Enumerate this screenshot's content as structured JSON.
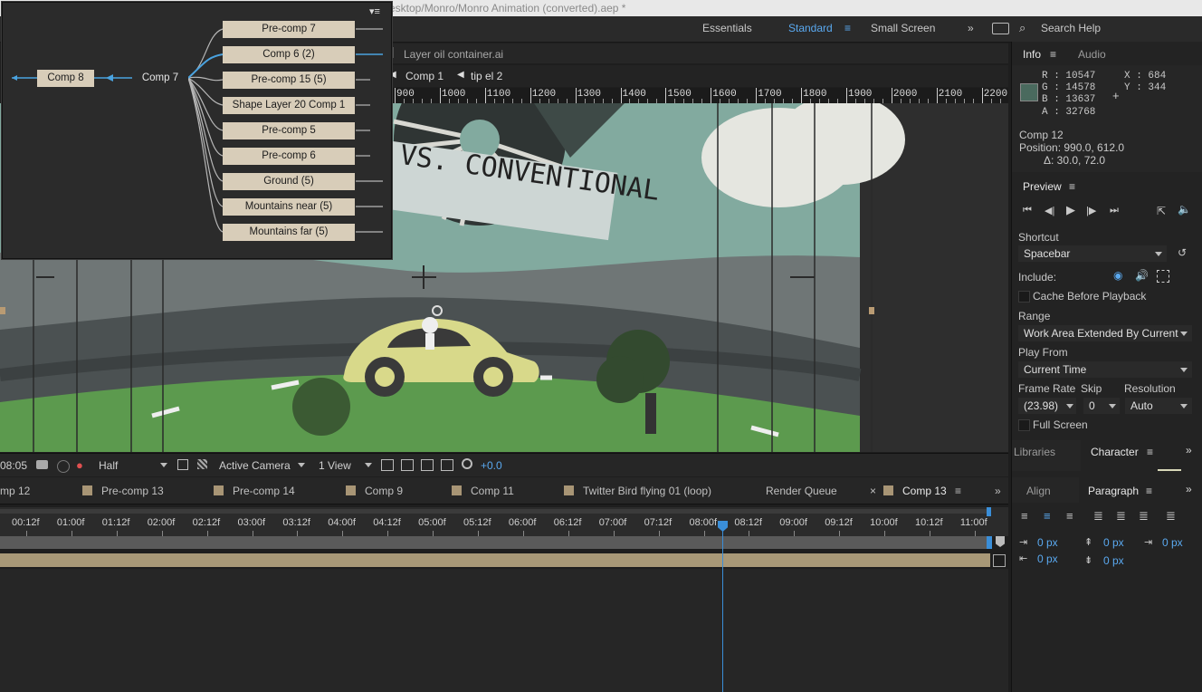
{
  "window": {
    "title": "esktop/Monro/Monro Animation (converted).aep *"
  },
  "workspaces": {
    "essentials": "Essentials",
    "standard": "Standard",
    "small_screen": "Small Screen",
    "overflow": "»",
    "search": "Search Help"
  },
  "viewer": {
    "layer_tab": "Layer oil container.ai",
    "breadcrumb": [
      "Comp 1",
      "tip el 2"
    ],
    "ruler": [
      "900",
      "1000",
      "1100",
      "1200",
      "1300",
      "1400",
      "1500",
      "1600",
      "1700",
      "1800",
      "1900",
      "2000",
      "2100",
      "2200"
    ],
    "banner_text": "VS. CONVENTIONAL",
    "controls": {
      "timecode": "08:05",
      "resolution": "Half",
      "camera": "Active Camera",
      "views": "1 View",
      "exposure": "+0.0"
    }
  },
  "flowchart": {
    "outputs": [
      "Comp 8",
      "Comp 7"
    ],
    "inputs": [
      "Pre-comp 7",
      "Comp 6 (2)",
      "Pre-comp 15 (5)",
      "Shape Layer 20 Comp 1",
      "Pre-comp 5",
      "Pre-comp 6",
      "Ground (5)",
      "Mountains near (5)",
      "Mountains far (5)"
    ]
  },
  "timeline": {
    "tabs": [
      "mp 12",
      "Pre-comp 13",
      "Pre-comp 14",
      "Comp 9",
      "Comp 11",
      "Twitter Bird flying 01 (loop)",
      "Render Queue",
      "Comp 13"
    ],
    "time_labels": [
      "00:12f",
      "01:00f",
      "01:12f",
      "02:00f",
      "02:12f",
      "03:00f",
      "03:12f",
      "04:00f",
      "04:12f",
      "05:00f",
      "05:12f",
      "06:00f",
      "06:12f",
      "07:00f",
      "07:12f",
      "08:00f",
      "08:12f",
      "09:00f",
      "09:12f",
      "10:00f",
      "10:12f",
      "11:00f"
    ],
    "playhead_time": "08:05"
  },
  "info": {
    "tab": "Info",
    "audio_tab": "Audio",
    "r": "R : 10547",
    "g": "G : 14578",
    "b": "B : 13637",
    "a": "A : 32768",
    "x": "X : 684",
    "y": "Y : 344",
    "swatch_color": "#4a6a5e",
    "comp": "Comp 12",
    "position": "Position: 990.0, 612.0",
    "delta": "Δ: 30.0, 72.0"
  },
  "preview": {
    "title": "Preview",
    "shortcut_label": "Shortcut",
    "shortcut_value": "Spacebar",
    "include_label": "Include:",
    "cache_label": "Cache Before Playback",
    "range_label": "Range",
    "range_value": "Work Area Extended By Current",
    "playfrom_label": "Play From",
    "playfrom_value": "Current Time",
    "framerate_label": "Frame Rate",
    "skip_label": "Skip",
    "resolution_label": "Resolution",
    "framerate_value": "(23.98)",
    "skip_value": "0",
    "resolution_value": "Auto",
    "fullscreen_label": "Full Screen"
  },
  "lower_panels": {
    "libraries": "Libraries",
    "character": "Character",
    "align": "Align",
    "paragraph": "Paragraph",
    "px": [
      "0 px",
      "0 px",
      "0 px",
      "0 px",
      "0 px"
    ]
  }
}
